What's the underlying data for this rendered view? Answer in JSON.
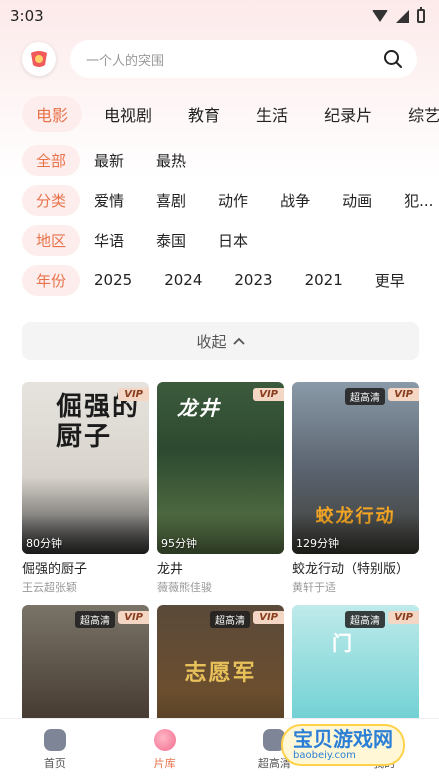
{
  "status_bar": {
    "time": "3:03"
  },
  "search": {
    "placeholder": "一个人的突围"
  },
  "category_tabs": [
    {
      "label": "电影",
      "active": true
    },
    {
      "label": "电视剧",
      "active": false
    },
    {
      "label": "教育",
      "active": false
    },
    {
      "label": "生活",
      "active": false
    },
    {
      "label": "纪录片",
      "active": false
    },
    {
      "label": "综艺",
      "active": false
    }
  ],
  "filters": {
    "sort": {
      "items": [
        "全部",
        "最新",
        "最热"
      ]
    },
    "genre": {
      "label": "分类",
      "items": [
        "爱情",
        "喜剧",
        "动作",
        "战争",
        "动画",
        "犯..."
      ]
    },
    "region": {
      "label": "地区",
      "items": [
        "华语",
        "泰国",
        "日本"
      ]
    },
    "year": {
      "label": "年份",
      "items": [
        "2025",
        "2024",
        "2023",
        "2021",
        "更早"
      ]
    }
  },
  "collapse": {
    "label": "收起"
  },
  "movies": [
    {
      "title": "倔强的厨子",
      "cast": "王云超张颖",
      "duration": "80分钟",
      "vip": "VIP",
      "hd": "",
      "art": "倔强的厨子"
    },
    {
      "title": "龙井",
      "cast": "薇薇熊佳骏",
      "duration": "95分钟",
      "vip": "VIP",
      "hd": "",
      "art": "龙井"
    },
    {
      "title": "蛟龙行动（特别版）",
      "cast": "黄轩于适",
      "duration": "129分钟",
      "vip": "VIP",
      "hd": "超高清",
      "art": "蛟龙行动"
    },
    {
      "title": "",
      "cast": "",
      "duration": "",
      "vip": "VIP",
      "hd": "超高清",
      "art": ""
    },
    {
      "title": "",
      "cast": "",
      "duration": "",
      "vip": "VIP",
      "hd": "超高清",
      "art": "志愿军"
    },
    {
      "title": "",
      "cast": "",
      "duration": "",
      "vip": "VIP",
      "hd": "超高清",
      "art": "门"
    }
  ],
  "bottom_nav": [
    {
      "label": "首页",
      "active": false
    },
    {
      "label": "片库",
      "active": true
    },
    {
      "label": "超高清",
      "active": false
    },
    {
      "label": "我的",
      "active": false
    }
  ],
  "watermark": {
    "text": "宝贝游戏网",
    "url": "baobeiy.com"
  }
}
